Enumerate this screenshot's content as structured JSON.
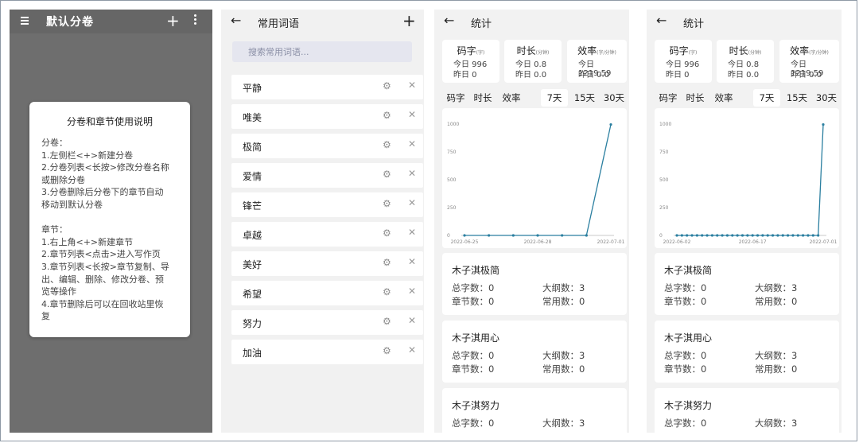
{
  "volume_screen": {
    "title": "默认分卷",
    "add_icon": "plus-icon",
    "dialog": {
      "title": "分卷和章节使用说明",
      "lines": [
        "分卷：",
        "1.左侧栏<+>新建分卷",
        "2.分卷列表<长按>修改分卷名称",
        "或删除分卷",
        "3.分卷删除后分卷下的章节自动",
        "移动到默认分卷",
        "",
        "章节：",
        "1.右上角<+>新建章节",
        "2.章节列表<点击>进入写作页",
        "3.章节列表<长按>章节复制、导",
        "出、编辑、删除、修改分卷、预",
        "览等操作",
        "4.章节删除后可以在回收站里恢",
        "复"
      ]
    }
  },
  "phrases_screen": {
    "title": "常用词语",
    "search_placeholder": "搜索常用词语...",
    "items": [
      "平静",
      "唯美",
      "极简",
      "爱情",
      "锋芒",
      "卓越",
      "美好",
      "希望",
      "努力",
      "加油"
    ]
  },
  "stats_screens": [
    {
      "title": "统计",
      "cards": [
        {
          "title": "码字",
          "unit": "(字)",
          "today": "今日 996",
          "yesterday": "昨日 0"
        },
        {
          "title": "时长",
          "unit": "(分钟)",
          "today": "今日 0.8",
          "yesterday": "昨日 0.0"
        },
        {
          "title": "效率",
          "unit": "(字/分钟)",
          "today": "今日 1219.59",
          "yesterday": "昨日 0.0"
        }
      ],
      "tabs": [
        "码字",
        "时长",
        "效率",
        "7天",
        "15天",
        "30天"
      ],
      "selected_tab": 3,
      "books": [
        {
          "name": "木子淇极简",
          "total": "总字数：0",
          "outline": "大纲数：3",
          "chapters": "章节数：0",
          "common": "常用数：0"
        },
        {
          "name": "木子淇用心",
          "total": "总字数：0",
          "outline": "大纲数：3",
          "chapters": "章节数：0",
          "common": "常用数：0"
        },
        {
          "name": "木子淇努力",
          "total": "总字数：0",
          "outline": "大纲数：3"
        }
      ]
    },
    {
      "title": "统计",
      "cards": [
        {
          "title": "码字",
          "unit": "(字)",
          "today": "今日 996",
          "yesterday": "昨日 0"
        },
        {
          "title": "时长",
          "unit": "(分钟)",
          "today": "今日 0.8",
          "yesterday": "昨日 0.0"
        },
        {
          "title": "效率",
          "unit": "(字/分钟)",
          "today": "今日 1219.59",
          "yesterday": "昨日 0.0"
        }
      ],
      "tabs": [
        "码字",
        "时长",
        "效率",
        "7天",
        "15天",
        "30天"
      ],
      "selected_tab": 3,
      "books": [
        {
          "name": "木子淇极简",
          "total": "总字数：0",
          "outline": "大纲数：3",
          "chapters": "章节数：0",
          "common": "常用数：0"
        },
        {
          "name": "木子淇用心",
          "total": "总字数：0",
          "outline": "大纲数：3",
          "chapters": "章节数：0",
          "common": "常用数：0"
        },
        {
          "name": "木子淇努力",
          "total": "总字数：0",
          "outline": "大纲数：3"
        }
      ]
    }
  ],
  "chart_data": [
    {
      "type": "line",
      "color": "#2b7fa0",
      "x_ticks": [
        "2022-06-25",
        "2022-06-28",
        "2022-07-01"
      ],
      "y_ticks": [
        0,
        250,
        500,
        750,
        1000
      ],
      "ylim": [
        0,
        1000
      ],
      "x": [
        "2022-06-25",
        "2022-06-26",
        "2022-06-27",
        "2022-06-28",
        "2022-06-29",
        "2022-06-30",
        "2022-07-01"
      ],
      "values": [
        0,
        0,
        0,
        0,
        0,
        0,
        996
      ]
    },
    {
      "type": "line",
      "color": "#2b7fa0",
      "x_ticks": [
        "2022-06-02",
        "2022-06-17",
        "2022-07-01"
      ],
      "y_ticks": [
        0,
        250,
        500,
        750,
        1000
      ],
      "ylim": [
        0,
        1000
      ],
      "x": [
        "2022-06-02",
        "2022-06-03",
        "2022-06-04",
        "2022-06-05",
        "2022-06-06",
        "2022-06-07",
        "2022-06-08",
        "2022-06-09",
        "2022-06-10",
        "2022-06-11",
        "2022-06-12",
        "2022-06-13",
        "2022-06-14",
        "2022-06-15",
        "2022-06-16",
        "2022-06-17",
        "2022-06-18",
        "2022-06-19",
        "2022-06-20",
        "2022-06-21",
        "2022-06-22",
        "2022-06-23",
        "2022-06-24",
        "2022-06-25",
        "2022-06-26",
        "2022-06-27",
        "2022-06-28",
        "2022-06-29",
        "2022-06-30",
        "2022-07-01"
      ],
      "values": [
        0,
        0,
        0,
        0,
        0,
        0,
        0,
        0,
        0,
        0,
        0,
        0,
        0,
        0,
        0,
        0,
        0,
        0,
        0,
        0,
        0,
        0,
        0,
        0,
        0,
        0,
        0,
        0,
        0,
        996
      ]
    }
  ]
}
